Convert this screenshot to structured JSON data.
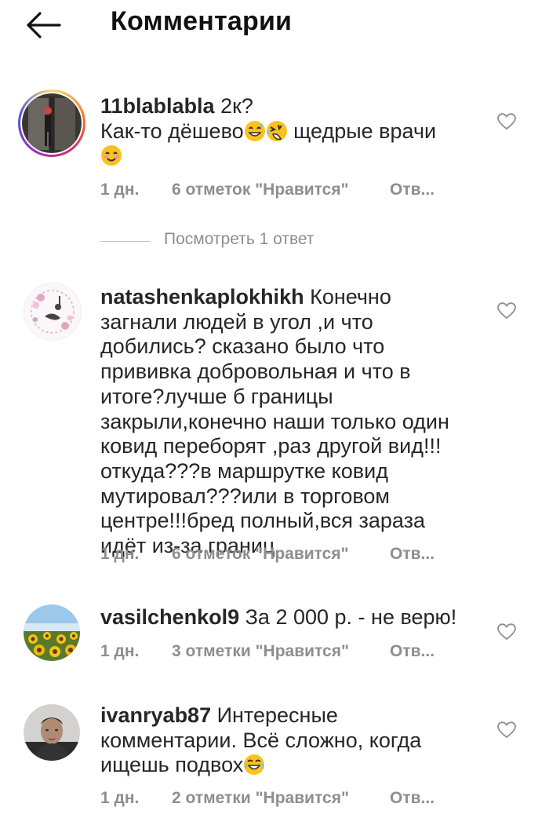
{
  "header": {
    "title": "Комментарии"
  },
  "comments": [
    {
      "username": "11blablabla",
      "text_before": "2к?\nКак-то дёшево",
      "text_after": " щедрые врачи",
      "time": "1 дн.",
      "likes": "6 отметок \"Нравится\"",
      "reply": "Отв..."
    },
    {
      "username": "natashenkaplokhikh",
      "text": "Конечно загнали людей в угол ,и что добились? сказано было что прививка добровольная и что в итоге?лучше б границы закрыли,конечно наши только один ковид переборят ,раз другой вид!!!откуда???в маршрутке ковид мутировал???или в торговом центре!!!бред полный,вся зараза идёт из-за границ",
      "time": "1 дн.",
      "likes": "6 отметок \"Нравится\"",
      "reply": "Отв..."
    },
    {
      "username": "vasilchenkol9",
      "text": "За 2 000 р. - не верю!",
      "time": "1 дн.",
      "likes": "3 отметки \"Нравится\"",
      "reply": "Отв..."
    },
    {
      "username": "ivanryab87",
      "text": "Интересные комментарии. Всё сложно, когда ищешь подвох",
      "time": "1 дн.",
      "likes": "2 отметки \"Нравится\"",
      "reply": "Отв..."
    }
  ],
  "view_replies": {
    "label": "Посмотреть 1 ответ"
  },
  "colors": {
    "text": "#262626",
    "muted": "#8e8e8e",
    "divider": "#c7c7c7"
  }
}
